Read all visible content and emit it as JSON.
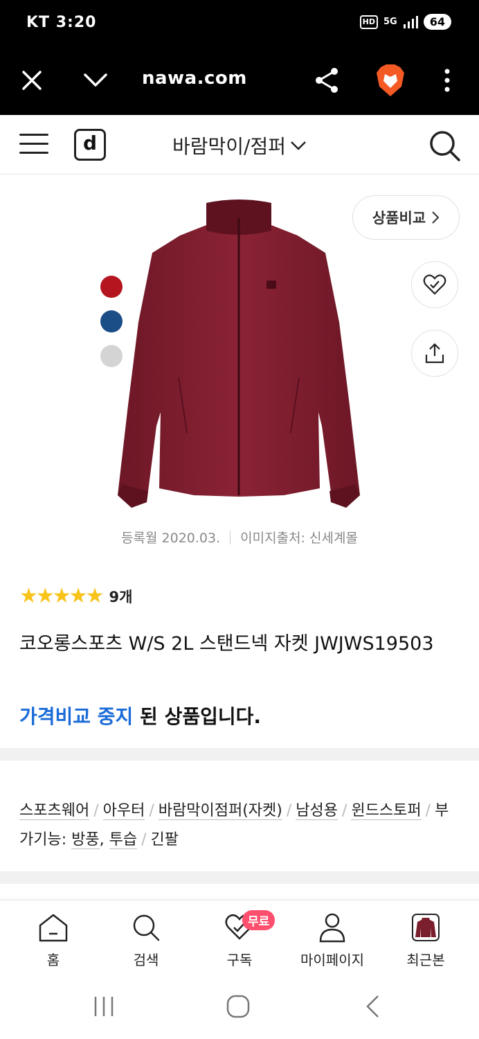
{
  "status_bar": {
    "carrier": "KT 3:20",
    "hd": "HD",
    "network": "5G",
    "battery": "64"
  },
  "browser": {
    "url": "nawa.com"
  },
  "header": {
    "category": "바람막이/점퍼",
    "logo": "d"
  },
  "product": {
    "compare_label": "상품비교",
    "swatch_colors": [
      "#b4151f",
      "#1b4d86",
      "#d4d4d4"
    ],
    "reg_date": "등록월 2020.03.",
    "image_source": "이미지출처: 신세계몰",
    "stars": "★★★★★",
    "rating_value": 5,
    "review_count": "9개",
    "title": "코오롱스포츠 W/S 2L 스탠드넥 자켓 JWJWS19503",
    "status_highlight": "가격비교 중지",
    "status_rest": " 된 상품입니다."
  },
  "tags": {
    "t1": "스포츠웨어",
    "t2": "아우터",
    "t3": "바람막이점퍼(자켓)",
    "t4": "남성용",
    "t5": "윈드스토퍼",
    "t6_prefix": "부가기능: ",
    "t6a": "방풍",
    "t6b": "투습",
    "t7": "긴팔",
    "separator": "/",
    "comma": ","
  },
  "bottom_nav": {
    "home": "홈",
    "search": "검색",
    "subscribe": "구독",
    "free_badge": "무료",
    "mypage": "마이페이지",
    "recent": "최근본"
  },
  "colors": {
    "accent_blue": "#1a6bd8",
    "star": "#f8c31a",
    "badge": "#ff4f6e",
    "jacket": "#7a1f2e"
  }
}
